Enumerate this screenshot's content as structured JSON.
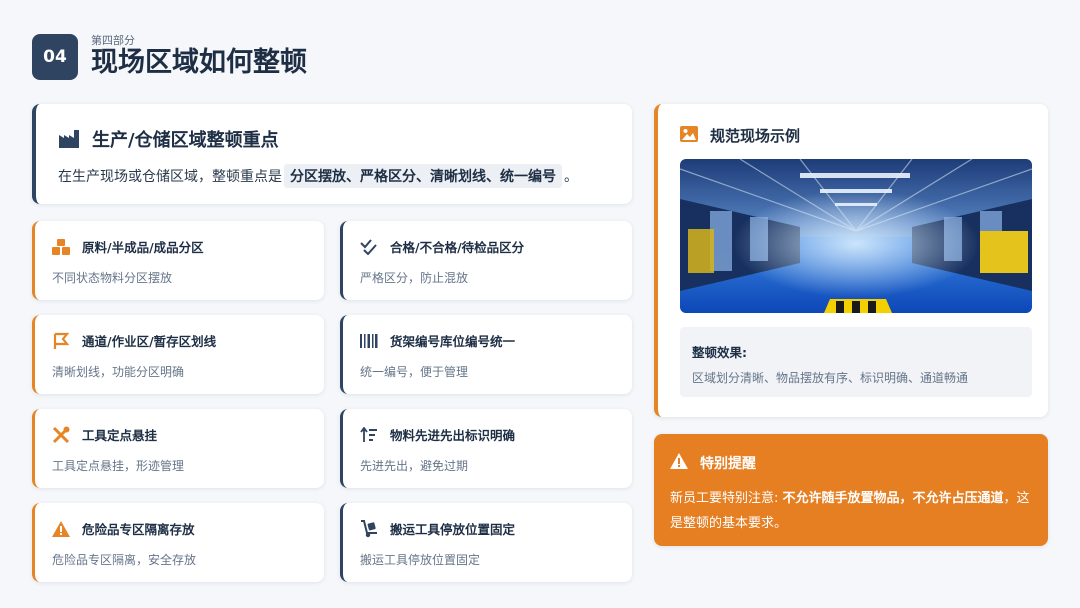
{
  "section": {
    "number": "04",
    "subtitle": "第四部分",
    "title": "现场区域如何整顿"
  },
  "intro": {
    "icon": "factory-icon",
    "title": "生产/仓储区域整顿重点",
    "text_prefix": "在生产现场或仓储区域，整顿重点是",
    "highlight": "分区摆放、严格区分、清晰划线、统一编号",
    "text_suffix": "。"
  },
  "items": [
    {
      "icon": "boxes-icon",
      "title": "原料/半成品/成品分区",
      "desc": "不同状态物料分区摆放"
    },
    {
      "icon": "check-double-icon",
      "title": "合格/不合格/待检品区分",
      "desc": "严格区分，防止混放"
    },
    {
      "icon": "flag-icon",
      "title": "通道/作业区/暂存区划线",
      "desc": "清晰划线，功能分区明确"
    },
    {
      "icon": "barcode-icon",
      "title": "货架编号库位编号统一",
      "desc": "统一编号，便于管理"
    },
    {
      "icon": "tools-icon",
      "title": "工具定点悬挂",
      "desc": "工具定点悬挂，形迹管理"
    },
    {
      "icon": "sort-up-icon",
      "title": "物料先进先出标识明确",
      "desc": "先进先出，避免过期"
    },
    {
      "icon": "warning-icon",
      "title": "危险品专区隔离存放",
      "desc": "危险品专区隔离，安全存放"
    },
    {
      "icon": "dolly-icon",
      "title": "搬运工具停放位置固定",
      "desc": "搬运工具停放位置固定"
    }
  ],
  "example": {
    "icon": "image-icon",
    "title": "规范现场示例",
    "effect_label": "整顿效果:",
    "effect_text": "区域划分清晰、物品摆放有序、标识明确、通道畅通"
  },
  "warning": {
    "icon": "warning-icon",
    "title": "特别提醒",
    "text_prefix": "新员工要特别注意: ",
    "text_bold": "不允许随手放置物品，不允许占压通道",
    "text_suffix": "，这是整顿的基本要求。"
  },
  "colors": {
    "navy": "#2e4460",
    "accent": "#e58525",
    "warning_bg": "#e67e22"
  }
}
